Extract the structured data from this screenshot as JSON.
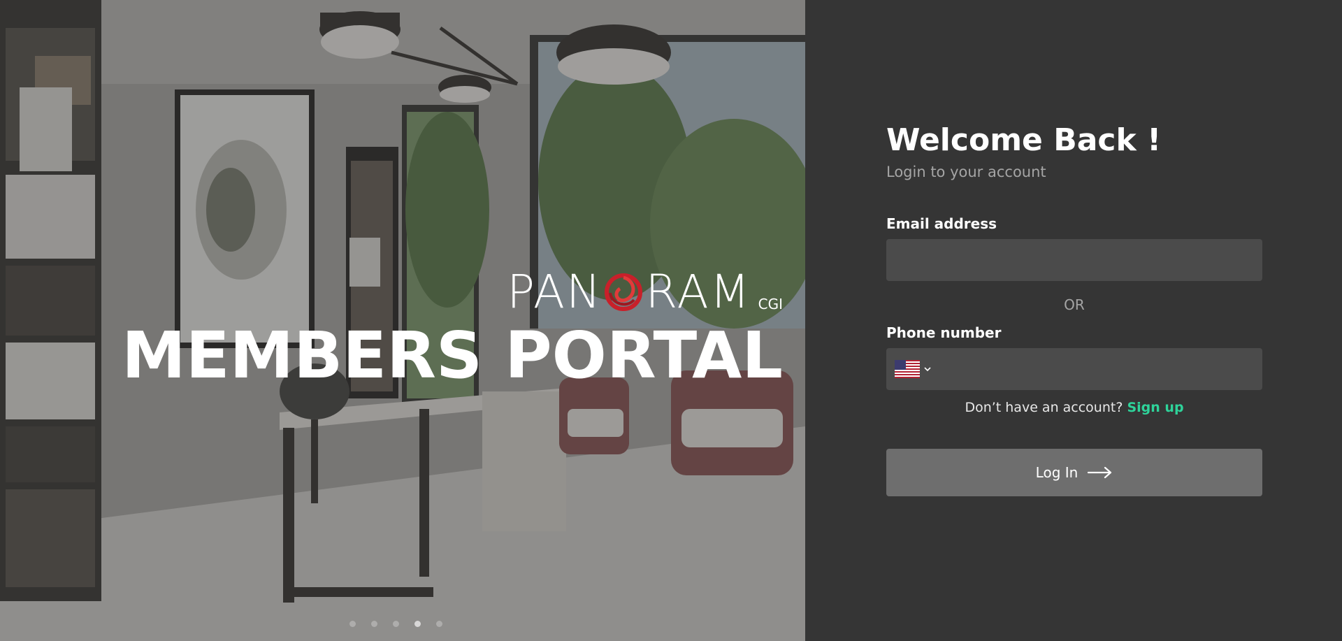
{
  "hero": {
    "brand_name": "PAN",
    "brand_name_tail": "RAM",
    "brand_suffix": "CGI",
    "heading": "MEMBERS PORTAL",
    "slide_count": 5,
    "active_slide": 4
  },
  "login": {
    "title": "Welcome Back !",
    "subtitle": "Login to your account",
    "email_label": "Email address",
    "email_value": "",
    "email_placeholder": "",
    "separator": "OR",
    "phone_label": "Phone number",
    "phone_value": "",
    "country_icon": "us-flag-icon",
    "signup_prompt": "Don’t have an account?",
    "signup_link": "Sign up",
    "button_label": "Log In",
    "button_icon": "arrow-right-icon"
  },
  "colors": {
    "panel_bg": "#353535",
    "input_bg": "#4b4b4b",
    "button_bg": "#6e6e6e",
    "accent": "#2ed39a",
    "logo_swirl": "#c8202a"
  }
}
